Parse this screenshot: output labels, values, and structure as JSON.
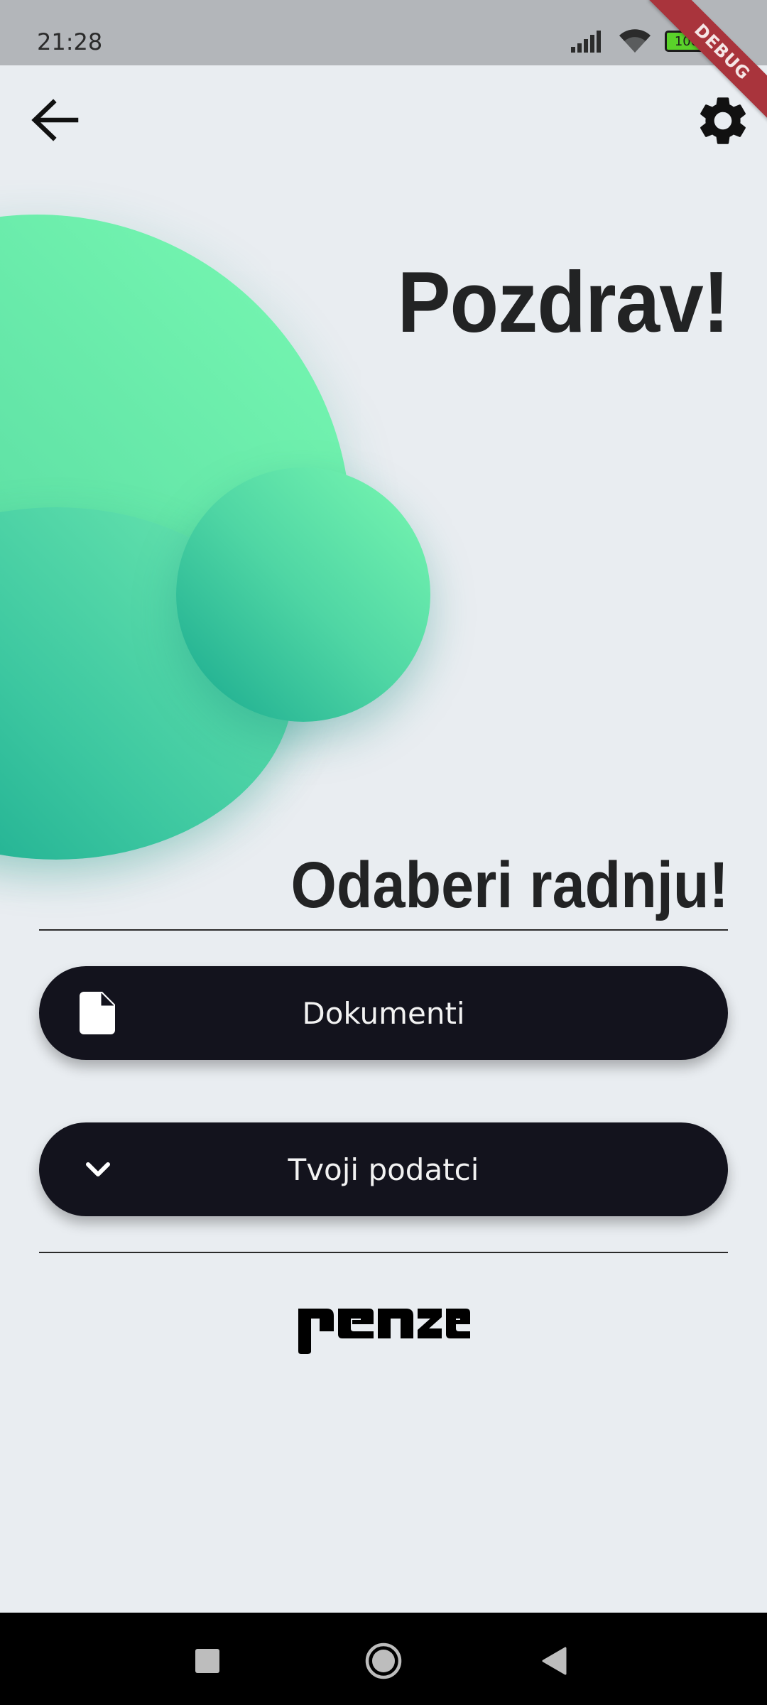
{
  "status_bar": {
    "time": "21:28",
    "battery_level": "100",
    "icons": [
      "signal-icon",
      "wifi-icon",
      "battery-icon"
    ]
  },
  "debug_banner": {
    "label": "DEBUG"
  },
  "app_bar": {
    "back_icon": "arrow-back-icon",
    "settings_icon": "gear-icon"
  },
  "main": {
    "greeting": "Pozdrav!",
    "prompt": "Odaberi radnju!",
    "actions": [
      {
        "label": "Dokumenti",
        "icon": "document-icon"
      },
      {
        "label": "Tvoji podatci",
        "icon": "chevron-down-icon"
      }
    ],
    "logo_text": "penze"
  },
  "nav_bar": {
    "buttons": [
      "recents-icon",
      "home-icon",
      "back-icon"
    ]
  },
  "colors": {
    "background": "#e9edf1",
    "button": "#13131d",
    "accent_green": "#5ee0a5",
    "accent_teal": "#17a88e",
    "heading": "#222324"
  }
}
